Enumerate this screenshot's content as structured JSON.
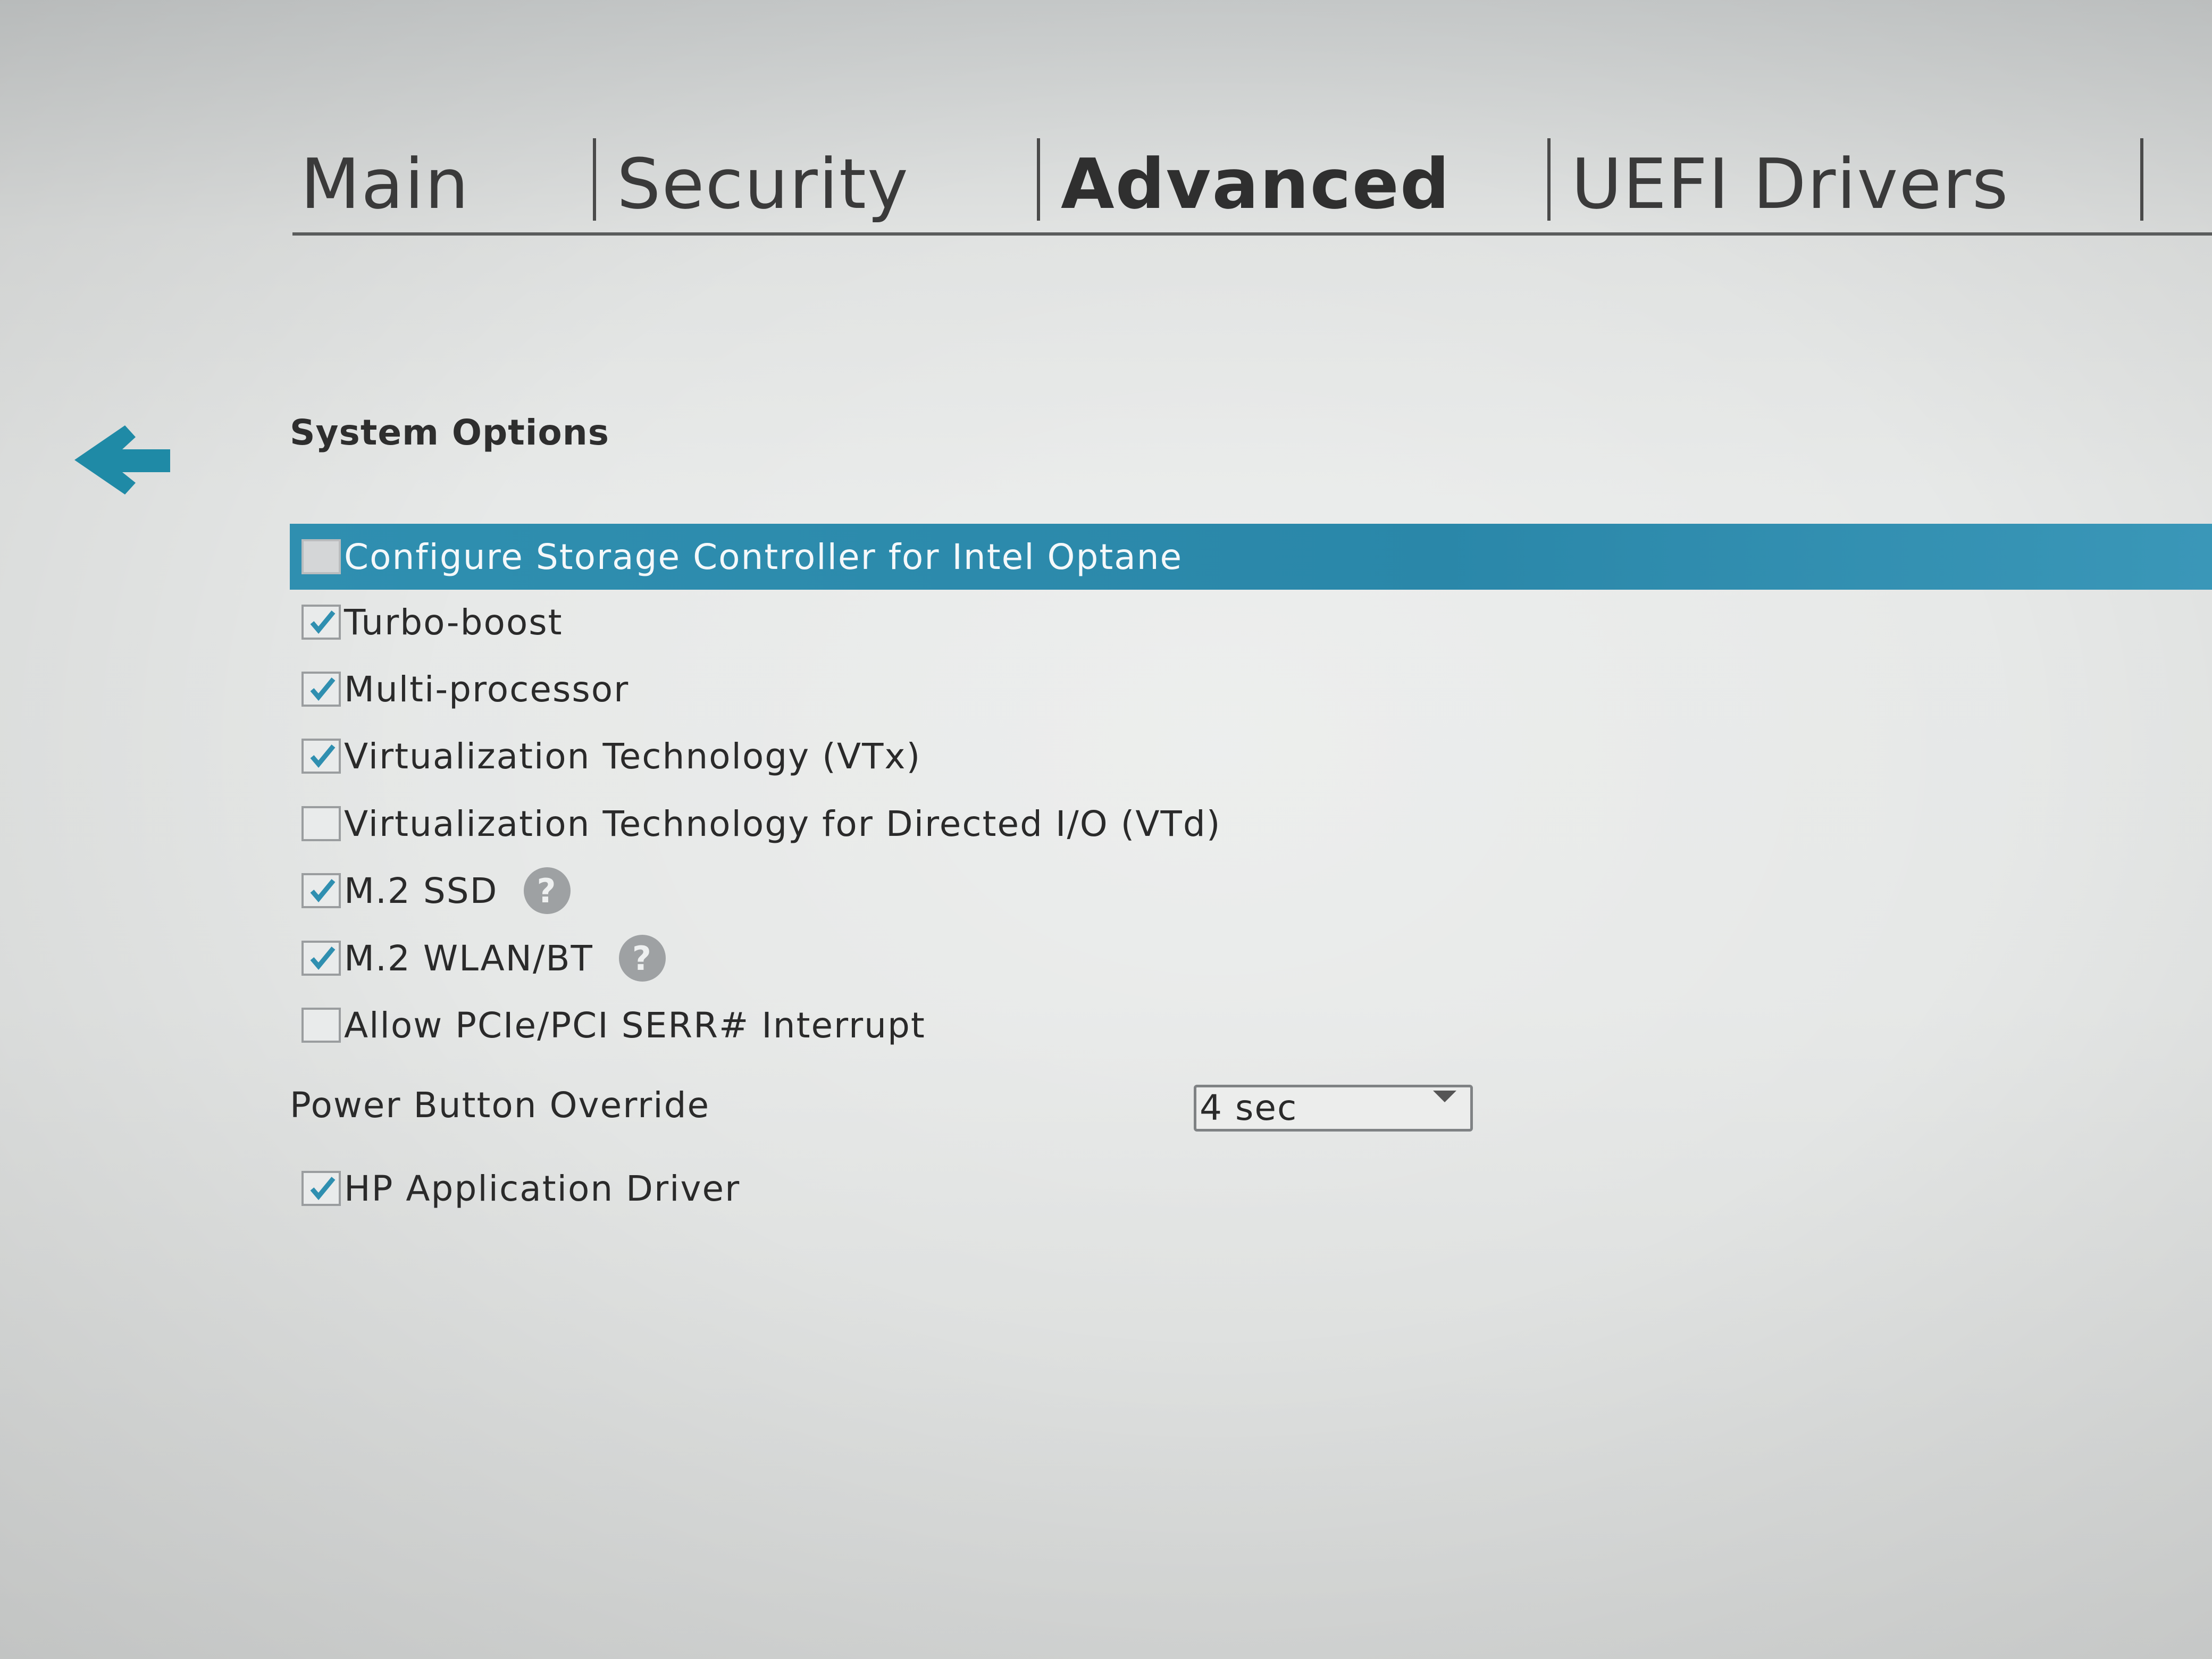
{
  "tabs": [
    {
      "label": "Main",
      "active": false
    },
    {
      "label": "Security",
      "active": false
    },
    {
      "label": "Advanced",
      "active": true
    },
    {
      "label": "UEFI Drivers",
      "active": false
    }
  ],
  "back_icon": "arrow-left-icon",
  "section_title": "System Options",
  "options": [
    {
      "label": "Configure Storage Controller for Intel Optane",
      "checked": false,
      "selected": true,
      "help": false
    },
    {
      "label": "Turbo-boost",
      "checked": true,
      "selected": false,
      "help": false
    },
    {
      "label": "Multi-processor",
      "checked": true,
      "selected": false,
      "help": false
    },
    {
      "label": "Virtualization Technology (VTx)",
      "checked": true,
      "selected": false,
      "help": false
    },
    {
      "label": "Virtualization Technology for Directed I/O (VTd)",
      "checked": false,
      "selected": false,
      "help": false
    },
    {
      "label": "M.2 SSD",
      "checked": true,
      "selected": false,
      "help": true
    },
    {
      "label": "M.2 WLAN/BT",
      "checked": true,
      "selected": false,
      "help": true
    },
    {
      "label": "Allow PCIe/PCI SERR# Interrupt",
      "checked": false,
      "selected": false,
      "help": false
    }
  ],
  "power_button_override": {
    "label": "Power Button Override",
    "value": "4 sec"
  },
  "hp_app_driver": {
    "label": "HP Application Driver",
    "checked": true
  },
  "help_glyph": "?",
  "colors": {
    "accent": "#2a87a9",
    "check": "#2f8fb0",
    "arrow": "#1f8aa6"
  }
}
